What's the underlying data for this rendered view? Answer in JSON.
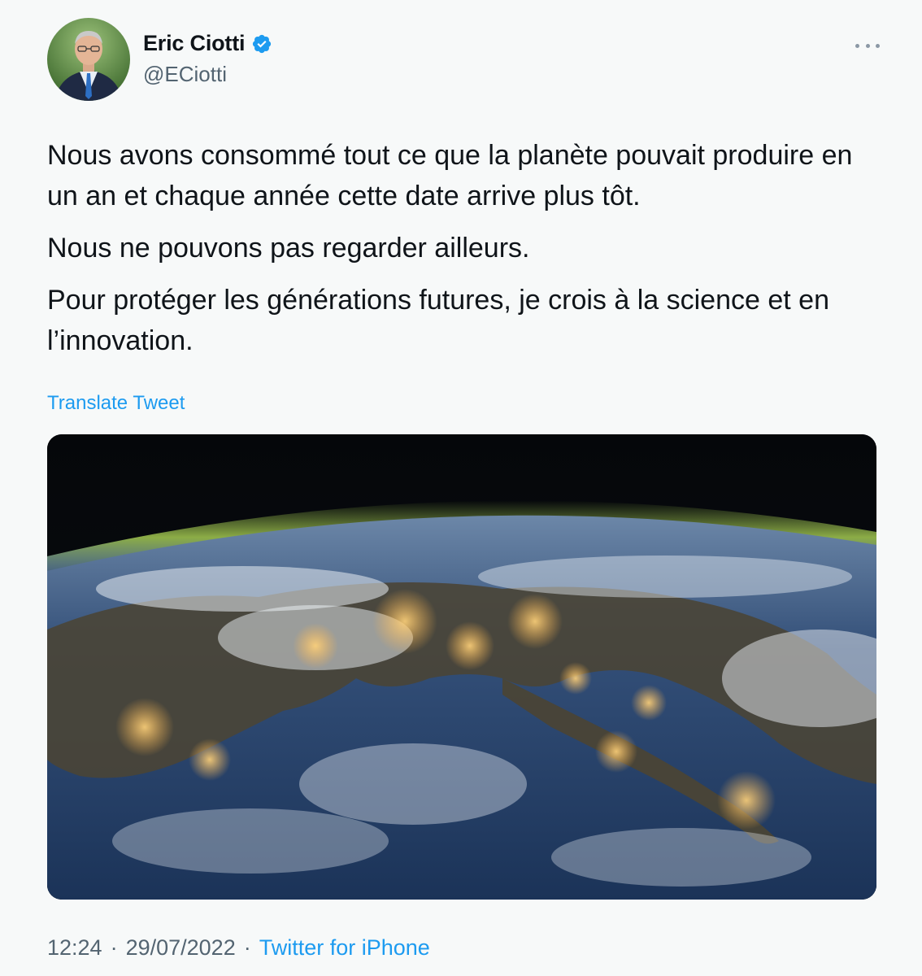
{
  "author": {
    "display_name": "Eric Ciotti",
    "handle": "@ECiotti",
    "verified": true
  },
  "tweet": {
    "paragraphs": [
      "Nous avons consommé tout ce que la planète pouvait produire en un an et chaque année cette date arrive plus tôt.",
      "Nous ne pouvons pas regarder ailleurs.",
      "Pour protéger les générations futures, je crois à la science et en l’innovation."
    ],
    "translate_label": "Translate Tweet"
  },
  "meta": {
    "time": "12:24",
    "separator": "·",
    "date": "29/07/2022",
    "source": "Twitter for iPhone"
  },
  "icons": {
    "verified": "verified-badge-icon",
    "more": "more-options-icon"
  },
  "colors": {
    "accent": "#1d9bf0",
    "secondary_text": "#536471",
    "primary_text": "#0f1419",
    "background": "#f7f9f9"
  }
}
